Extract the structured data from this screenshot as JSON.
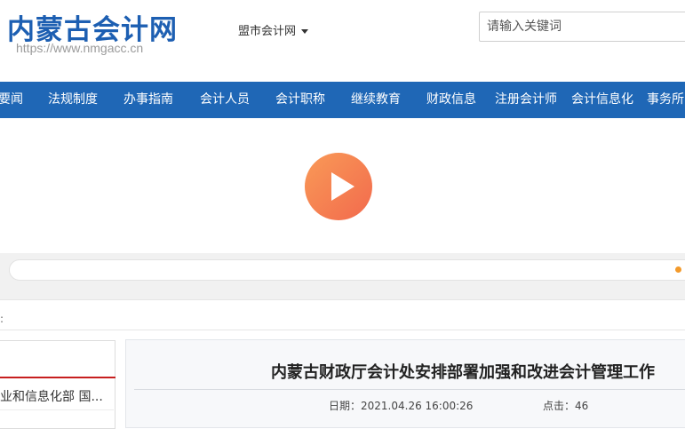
{
  "header": {
    "site_title": "内蒙古会计网",
    "site_url": "https://www.nmgacc.cn",
    "city_select_label": "盟市会计网",
    "search_placeholder": "请输入关键词"
  },
  "nav": {
    "items": [
      "要闻",
      "法规制度",
      "办事指南",
      "会计人员",
      "会计职称",
      "继续教育",
      "财政信息",
      "注册会计师",
      "会计信息化",
      "事务所"
    ]
  },
  "breadcrumb": {
    "separator": ":"
  },
  "sidebar": {
    "items": [
      "业和信息化部 国..."
    ]
  },
  "article": {
    "title": "内蒙古财政厅会计处安排部署加强和改进会计管理工作",
    "date_text": "日期：2021.04.26 16:00:26",
    "views_text": "点击：46"
  },
  "colors": {
    "brand_blue": "#1d5fb2",
    "nav_blue": "#1f67b6",
    "play_orange": "#f4784f",
    "accent_red": "#c71f1f"
  }
}
